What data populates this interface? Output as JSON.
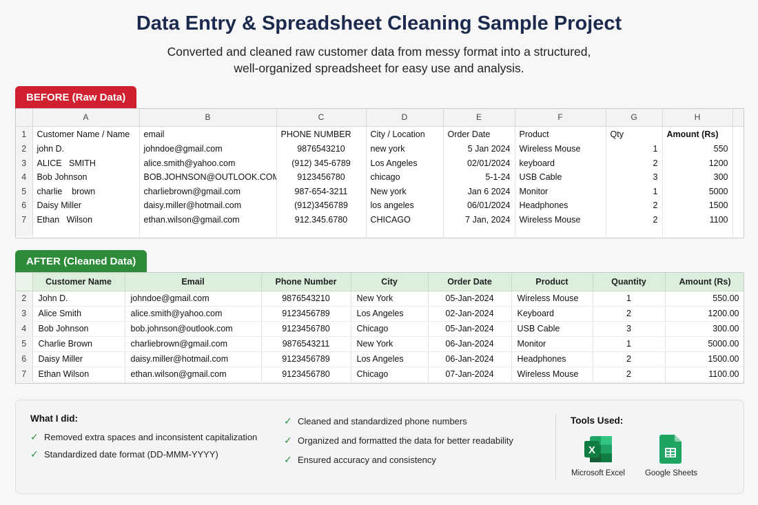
{
  "header": {
    "title": "Data Entry & Spreadsheet Cleaning Sample Project",
    "subtitle_line1": "Converted and cleaned raw customer data from messy format into a structured,",
    "subtitle_line2": "well-organized spreadsheet for easy use and analysis."
  },
  "before": {
    "tag": "BEFORE (Raw Data)",
    "col_letters": [
      "A",
      "B",
      "C",
      "D",
      "E",
      "F",
      "G",
      "H"
    ],
    "header_row_num": "1",
    "headers": [
      "Customer Name / Name",
      "email",
      "PHONE NUMBER",
      "City / Location",
      "Order Date",
      "Product",
      "Qty",
      "Amount (Rs)"
    ],
    "rows": [
      {
        "num": "2",
        "name": "john D.",
        "email": "johndoe@gmail.com",
        "phone": "9876543210",
        "city": "new york",
        "date": "5 Jan 2024",
        "product": "Wireless Mouse",
        "qty": "1",
        "amount": "550"
      },
      {
        "num": "3",
        "name": "ALICE   SMITH",
        "email": "alice.smith@yahoo.com",
        "phone": "(912) 345-6789",
        "city": "Los Angeles",
        "date": "02/01/2024",
        "product": "keyboard",
        "qty": "2",
        "amount": "1200"
      },
      {
        "num": "4",
        "name": "Bob Johnson",
        "email": "BOB.JOHNSON@OUTLOOK.COM",
        "phone": "9123456780",
        "city": "chicago",
        "date": "5-1-24",
        "product": "USB Cable",
        "qty": "3",
        "amount": "300"
      },
      {
        "num": "5",
        "name": "charlie    brown",
        "email": "charliebrown@gmail.com",
        "phone": "987-654-3211",
        "city": "New york",
        "date": "Jan 6 2024",
        "product": "Monitor",
        "qty": "1",
        "amount": "5000"
      },
      {
        "num": "6",
        "name": "Daisy Miller",
        "email": "daisy.miller@hotmail.com",
        "phone": "(912)3456789",
        "city": "los angeles",
        "date": "06/01/2024",
        "product": "Headphones",
        "qty": "2",
        "amount": "1500"
      },
      {
        "num": "7",
        "name": "Ethan   Wilson",
        "email": "ethan.wilson@gmail.com",
        "phone": "912.345.6780",
        "city": "CHICAGO",
        "date": "7 Jan, 2024",
        "product": "Wireless Mouse",
        "qty": "2",
        "amount": "1100"
      }
    ]
  },
  "after": {
    "tag": "AFTER (Cleaned Data)",
    "headers": [
      "Customer Name",
      "Email",
      "Phone Number",
      "City",
      "Order Date",
      "Product",
      "Quantity",
      "Amount (Rs)"
    ],
    "rows": [
      {
        "num": "2",
        "name": "John D.",
        "email": "johndoe@gmail.com",
        "phone": "9876543210",
        "city": "New York",
        "date": "05-Jan-2024",
        "product": "Wireless Mouse",
        "qty": "1",
        "amount": "550.00"
      },
      {
        "num": "3",
        "name": "Alice Smith",
        "email": "alice.smith@yahoo.com",
        "phone": "9123456789",
        "city": "Los Angeles",
        "date": "02-Jan-2024",
        "product": "Keyboard",
        "qty": "2",
        "amount": "1200.00"
      },
      {
        "num": "4",
        "name": "Bob Johnson",
        "email": "bob.johnson@outlook.com",
        "phone": "9123456780",
        "city": "Chicago",
        "date": "05-Jan-2024",
        "product": "USB Cable",
        "qty": "3",
        "amount": "300.00"
      },
      {
        "num": "5",
        "name": "Charlie Brown",
        "email": "charliebrown@gmail.com",
        "phone": "9876543211",
        "city": "New York",
        "date": "06-Jan-2024",
        "product": "Monitor",
        "qty": "1",
        "amount": "5000.00"
      },
      {
        "num": "6",
        "name": "Daisy Miller",
        "email": "daisy.miller@hotmail.com",
        "phone": "9123456789",
        "city": "Los Angeles",
        "date": "06-Jan-2024",
        "product": "Headphones",
        "qty": "2",
        "amount": "1500.00"
      },
      {
        "num": "7",
        "name": "Ethan Wilson",
        "email": "ethan.wilson@gmail.com",
        "phone": "9123456780",
        "city": "Chicago",
        "date": "07-Jan-2024",
        "product": "Wireless Mouse",
        "qty": "2",
        "amount": "1100.00"
      }
    ]
  },
  "summary": {
    "heading": "What I did:",
    "items_left": [
      "Removed extra spaces and inconsistent capitalization",
      "Standardized date format (DD-MMM-YYYY)"
    ],
    "items_right": [
      "Cleaned and standardized phone numbers",
      "Organized and formatted the data for better readability",
      "Ensured accuracy and consistency"
    ],
    "tools_heading": "Tools Used:",
    "tools": [
      {
        "name": "Microsoft Excel",
        "icon": "excel-icon",
        "color": "#107c41"
      },
      {
        "name": "Google Sheets",
        "icon": "google-sheets-icon",
        "color": "#1fa463"
      }
    ],
    "check_icon": "check-icon",
    "check_color": "#2e8b3a"
  },
  "colors": {
    "before_tag": "#d0202f",
    "after_tag": "#2e8b3a",
    "after_header_bg": "#dcefdc",
    "title": "#1c2a4d"
  }
}
